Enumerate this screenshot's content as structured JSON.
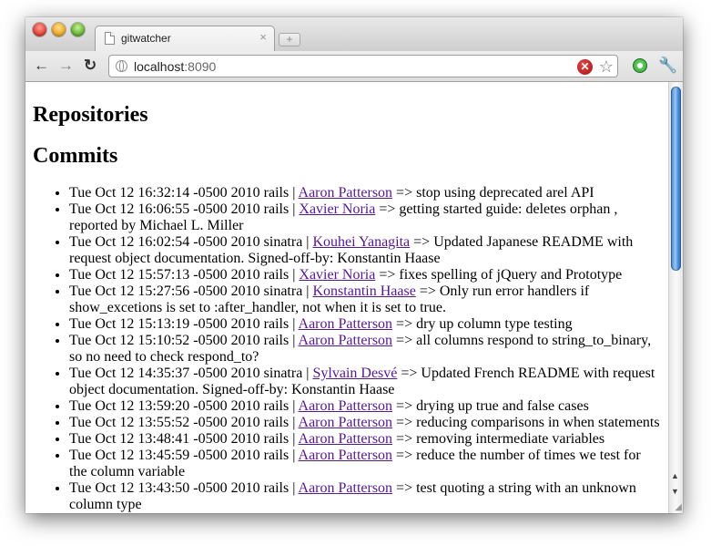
{
  "browser": {
    "tab_title": "gitwatcher",
    "tab_close": "×",
    "new_tab": "+",
    "url_host": "localhost",
    "url_port": ":8090",
    "back": "←",
    "forward": "→",
    "reload": "↻",
    "blocked": "✕",
    "star": "☆",
    "wrench": "🔧"
  },
  "page": {
    "heading_repositories": "Repositories",
    "heading_commits": "Commits",
    "commits": [
      {
        "date": "Tue Oct 12 16:32:14 -0500 2010",
        "repo": "rails",
        "author": "Aaron Patterson",
        "message": "stop using deprecated arel API"
      },
      {
        "date": "Tue Oct 12 16:06:55 -0500 2010",
        "repo": "rails",
        "author": "Xavier Noria",
        "message": "getting started guide: deletes orphan , reported by Michael L. Miller"
      },
      {
        "date": "Tue Oct 12 16:02:54 -0500 2010",
        "repo": "sinatra",
        "author": "Kouhei Yanagita",
        "message": "Updated Japanese README with request object documentation. Signed-off-by: Konstantin Haase"
      },
      {
        "date": "Tue Oct 12 15:57:13 -0500 2010",
        "repo": "rails",
        "author": "Xavier Noria",
        "message": "fixes spelling of jQuery and Prototype"
      },
      {
        "date": "Tue Oct 12 15:27:56 -0500 2010",
        "repo": "sinatra",
        "author": "Konstantin Haase",
        "message": "Only run error handlers if show_excetions is set to :after_handler, not when it is set to true."
      },
      {
        "date": "Tue Oct 12 15:13:19 -0500 2010",
        "repo": "rails",
        "author": "Aaron Patterson",
        "message": "dry up column type testing"
      },
      {
        "date": "Tue Oct 12 15:10:52 -0500 2010",
        "repo": "rails",
        "author": "Aaron Patterson",
        "message": "all columns respond to string_to_binary, so no need to check respond_to?"
      },
      {
        "date": "Tue Oct 12 14:35:37 -0500 2010",
        "repo": "sinatra",
        "author": "Sylvain Desvé",
        "message": "Updated French README with request object documentation. Signed-off-by: Konstantin Haase"
      },
      {
        "date": "Tue Oct 12 13:59:20 -0500 2010",
        "repo": "rails",
        "author": "Aaron Patterson",
        "message": "drying up true and false cases"
      },
      {
        "date": "Tue Oct 12 13:55:52 -0500 2010",
        "repo": "rails",
        "author": "Aaron Patterson",
        "message": "reducing comparisons in when statements"
      },
      {
        "date": "Tue Oct 12 13:48:41 -0500 2010",
        "repo": "rails",
        "author": "Aaron Patterson",
        "message": "removing intermediate variables"
      },
      {
        "date": "Tue Oct 12 13:45:59 -0500 2010",
        "repo": "rails",
        "author": "Aaron Patterson",
        "message": "reduce the number of times we test for the column variable"
      },
      {
        "date": "Tue Oct 12 13:43:50 -0500 2010",
        "repo": "rails",
        "author": "Aaron Patterson",
        "message": "test quoting a string with an unknown column type"
      }
    ],
    "separator": "|",
    "arrow": "=>"
  }
}
